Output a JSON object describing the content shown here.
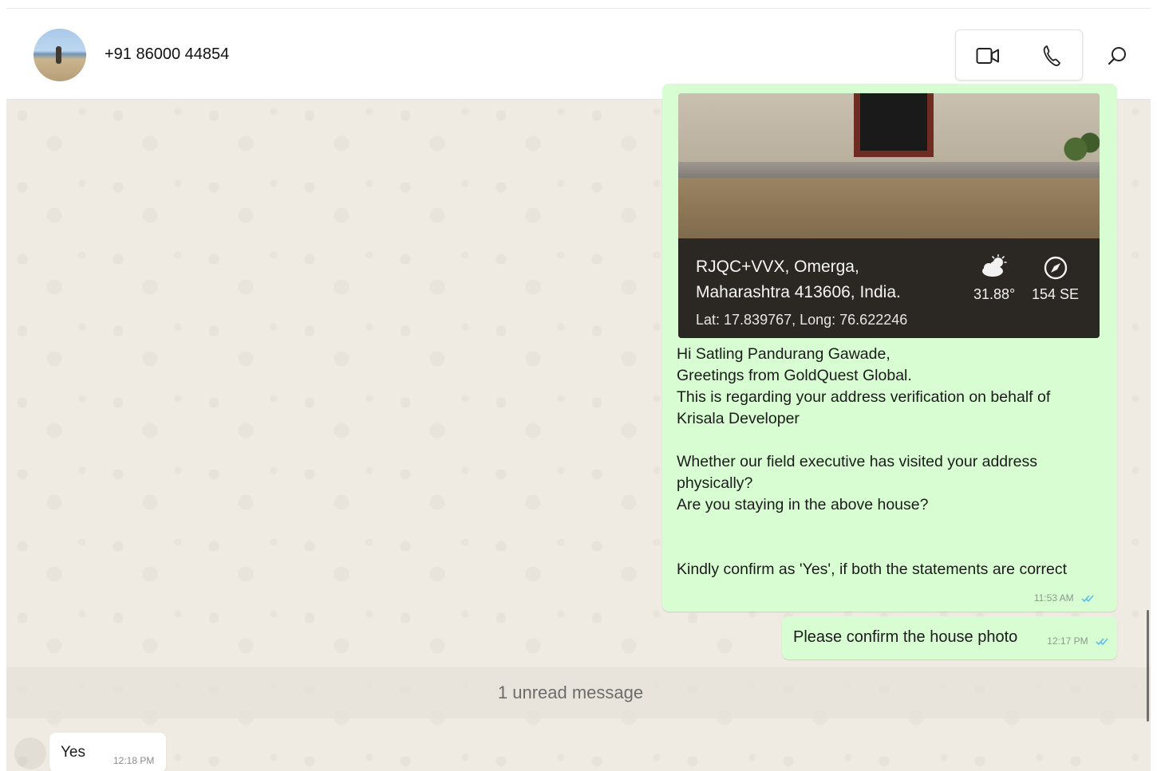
{
  "header": {
    "contact_name": "+91 86000 44854",
    "video_call_icon": "video-camera-icon",
    "voice_call_icon": "phone-icon",
    "search_icon": "search-icon"
  },
  "messages": {
    "photo_card": {
      "address_line1": "RJQC+VVX, Omerga,",
      "address_line2": "Maharashtra 413606, India.",
      "lat_long": "Lat: 17.839767, Long: 76.622246",
      "temperature": "31.88°",
      "bearing": "154 SE"
    },
    "main_message": {
      "line1": "Hi Satling Pandurang Gawade,",
      "line2": "Greetings from GoldQuest Global.",
      "line3": "This is regarding your address verification on behalf of Krisala Developer",
      "line4": "Whether our field executive has visited your address physically?",
      "line5": "Are you staying in the above house?",
      "line6": "Kindly confirm as 'Yes', if both the statements are correct",
      "time": "11:53 AM"
    },
    "second_message": {
      "text": "Please confirm the house photo",
      "time": "12:17 PM"
    },
    "unread_label": "1 unread message",
    "reply": {
      "text": "Yes",
      "time": "12:18 PM"
    }
  },
  "colors": {
    "outgoing_bubble": "#d9fdd3",
    "incoming_bubble": "#ffffff",
    "chat_background": "#efeae2",
    "read_ticks": "#53bdeb"
  }
}
